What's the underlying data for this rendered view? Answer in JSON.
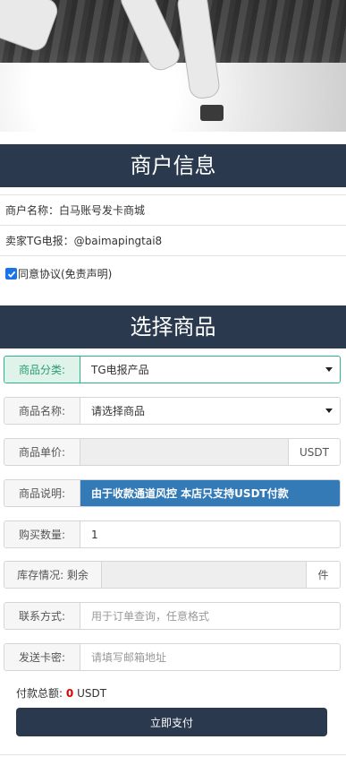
{
  "merchant_section": {
    "title": "商户信息",
    "name_label": "商户名称：",
    "name_value": "白马账号发卡商城",
    "tg_label": "卖家TG电报：",
    "tg_value": "@baimapingtai8",
    "agree_label": "同意协议(免责声明)",
    "agree_checked": true
  },
  "product_section": {
    "title": "选择商品",
    "category": {
      "label": "商品分类:",
      "value": "TG电报产品"
    },
    "product_name": {
      "label": "商品名称:",
      "value": "请选择商品"
    },
    "unit_price": {
      "label": "商品单价:",
      "value": "",
      "suffix": "USDT"
    },
    "description": {
      "label": "商品说明:",
      "value": "由于收款通道风控 本店只支持USDT付款"
    },
    "quantity": {
      "label": "购买数量:",
      "value": "1"
    },
    "stock": {
      "label": "库存情况: 剩余",
      "value": "",
      "suffix": "件"
    },
    "contact": {
      "label": "联系方式:",
      "placeholder": "用于订单查询，任意格式"
    },
    "send_card": {
      "label": "发送卡密:",
      "placeholder": "请填写邮箱地址"
    },
    "total": {
      "label": "付款总额:",
      "amount": "0",
      "currency": "USDT"
    },
    "pay_button": "立即支付"
  },
  "colors": {
    "header_bg": "#2a394e",
    "category_accent": "#2db38c",
    "description_bg": "#337ab7",
    "total_amount": "#e00000"
  }
}
